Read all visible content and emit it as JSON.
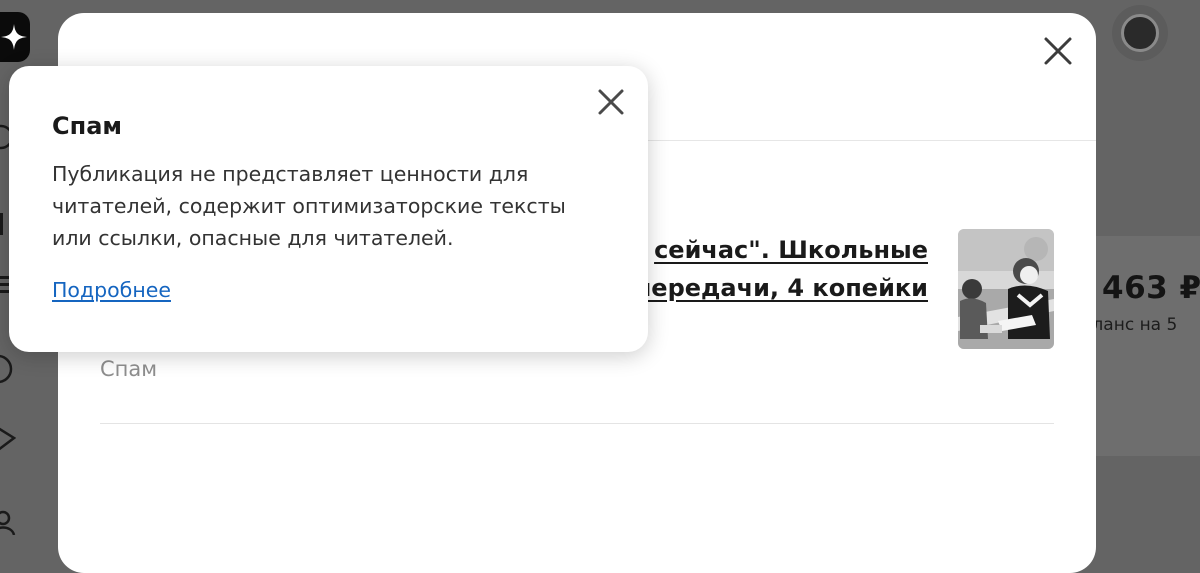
{
  "background": {
    "logo_icon": "star-icon",
    "balance": "463 ₽",
    "balance_note": "аланс на 5"
  },
  "modal": {
    "close_icon": "close-icon",
    "article_title_lines": [
      "сейчас\". Школьные",
      "передачи, 4 копейки"
    ],
    "reason": "Спам"
  },
  "popover": {
    "title": "Спам",
    "description": "Публикация не представляет ценности для читателей, содержит оптимизаторские тексты или ссылки, опасные для читателей.",
    "link": "Подробнее",
    "close_icon": "close-icon"
  }
}
